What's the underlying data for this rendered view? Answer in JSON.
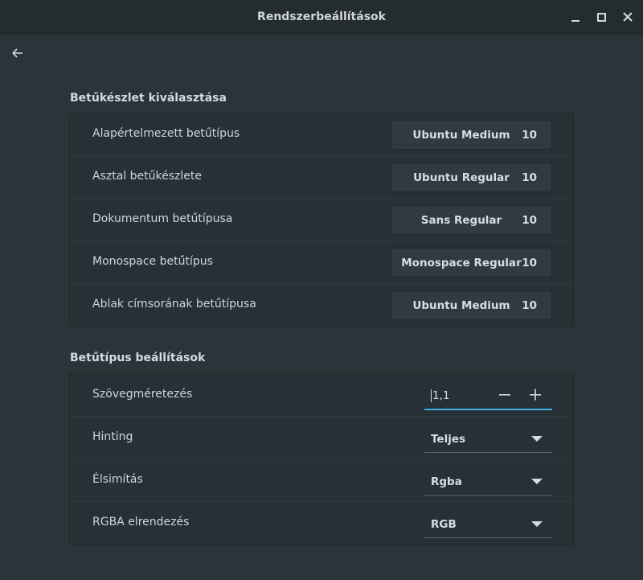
{
  "window": {
    "title": "Rendszerbeállítások"
  },
  "icons": {
    "back": "arrow-left-icon",
    "minimize": "minimize-icon",
    "maximize": "maximize-icon",
    "close": "close-icon",
    "minus": "minus-icon",
    "plus": "plus-icon",
    "dropdown": "triangle-down-icon"
  },
  "colors": {
    "accent": "#3daee9",
    "background": "#2b3439",
    "panel": "#263035"
  },
  "font_selection": {
    "title": "Betűkészlet kiválasztása",
    "rows": [
      {
        "label": "Alapértelmezett betűtípus",
        "font": "Ubuntu Medium",
        "size": "10"
      },
      {
        "label": "Asztal betűkészlete",
        "font": "Ubuntu Regular",
        "size": "10"
      },
      {
        "label": "Dokumentum betűtípusa",
        "font": "Sans Regular",
        "size": "10"
      },
      {
        "label": "Monospace betűtípus",
        "font": "Monospace Regular",
        "size": "10"
      },
      {
        "label": "Ablak címsorának betűtípusa",
        "font": "Ubuntu Medium",
        "size": "10"
      }
    ]
  },
  "font_settings": {
    "title": "Betűtípus beállítások",
    "scaling": {
      "label": "Szövegméretezés",
      "value": "1,1"
    },
    "hinting": {
      "label": "Hinting",
      "value": "Teljes"
    },
    "antialiasing": {
      "label": "Élsimítás",
      "value": "Rgba"
    },
    "rgba_order": {
      "label": "RGBA elrendezés",
      "value": "RGB"
    }
  }
}
